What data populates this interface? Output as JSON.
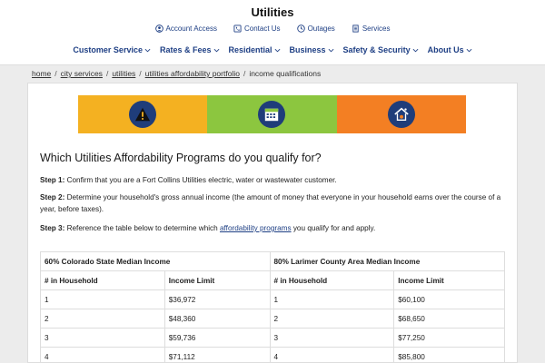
{
  "header": {
    "title": "Utilities",
    "util_links": [
      {
        "label": "Account Access",
        "icon": "user-circle-icon"
      },
      {
        "label": "Contact Us",
        "icon": "phone-icon"
      },
      {
        "label": "Outages",
        "icon": "clock-icon"
      },
      {
        "label": "Services",
        "icon": "document-icon"
      }
    ],
    "nav": [
      {
        "label": "Customer Service"
      },
      {
        "label": "Rates & Fees"
      },
      {
        "label": "Residential"
      },
      {
        "label": "Business"
      },
      {
        "label": "Safety & Security"
      },
      {
        "label": "About Us"
      }
    ]
  },
  "breadcrumb": [
    "home",
    "city services",
    "utilities",
    "utilities affordability portfolio",
    "income qualifications"
  ],
  "banner": {
    "colors": [
      "#f4b121",
      "#8cc63f",
      "#f37f23"
    ],
    "icons": [
      "warning-icon",
      "calendar-icon",
      "house-icon"
    ]
  },
  "main": {
    "heading": "Which Utilities Affordability Programs do you qualify for?",
    "step1_label": "Step 1:",
    "step1_text": " Confirm that you are a Fort Collins Utilities electric, water or wastewater customer.",
    "step2_label": "Step 2:",
    "step2_text": " Determine your household's gross annual income (the amount of money that everyone in your household earns over the course of a year, before taxes).",
    "step3_label": "Step 3:",
    "step3_pre": " Reference the table below to determine which ",
    "step3_link": "affordability programs",
    "step3_post": " you qualify for and apply."
  },
  "table": {
    "group_left": "60% Colorado State Median Income",
    "group_right": "80% Larimer County Area Median Income",
    "col_household": "# in Household",
    "col_limit": "Income Limit",
    "rows": [
      {
        "n": "1",
        "left": "$36,972",
        "right": "$60,100"
      },
      {
        "n": "2",
        "left": "$48,360",
        "right": "$68,650"
      },
      {
        "n": "3",
        "left": "$59,736",
        "right": "$77,250"
      },
      {
        "n": "4",
        "left": "$71,112",
        "right": "$85,800"
      }
    ]
  }
}
